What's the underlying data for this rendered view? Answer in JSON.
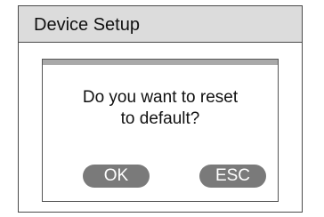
{
  "window": {
    "title": "Device Setup"
  },
  "dialog": {
    "message_line1": "Do you want to reset",
    "message_line2": "to default?",
    "ok_label": "OK",
    "esc_label": "ESC"
  },
  "colors": {
    "titlebar_bg": "#dcdcdc",
    "button_bg": "#7a7a7a",
    "dialog_band": "#a9a9a9",
    "border": "#4a4a4a"
  }
}
